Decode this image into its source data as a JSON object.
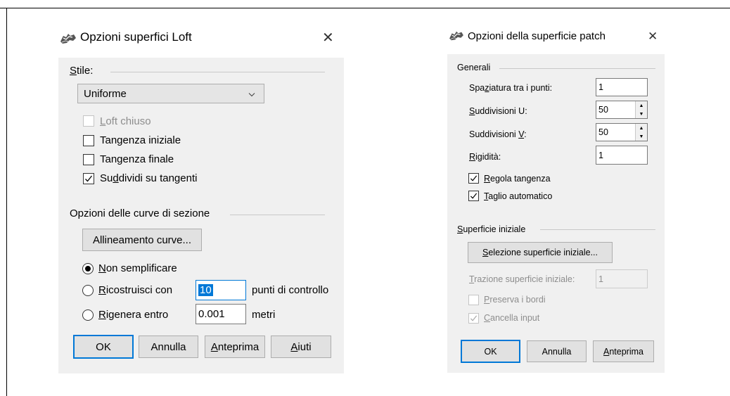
{
  "loft": {
    "title": "Opzioni superfici Loft",
    "style_label": "Stile:",
    "style_value": "Uniforme",
    "closed_loft": "Loft chiuso",
    "start_tangent": "Tangenza iniziale",
    "end_tangent": "Tangenza finale",
    "split_tangent": "Suddividi su tangenti",
    "section_header": "Opzioni delle curve di sezione",
    "align_curves": "Allineamento curve...",
    "no_simplify": "Non semplificare",
    "rebuild_with": "Ricostruisci con",
    "rebuild_value": "10",
    "control_points": "punti di controllo",
    "refit_within": "Rigenera entro",
    "refit_value": "0.001",
    "units": "metri",
    "ok": "OK",
    "cancel": "Annulla",
    "preview": "Anteprima",
    "help": "Aiuti"
  },
  "patch": {
    "title": "Opzioni della superficie patch",
    "general": "Generali",
    "point_spacing_label": "Spaziatura tra i punti:",
    "point_spacing_value": "1",
    "u_spans_label": "Suddivisioni U:",
    "u_spans_value": "50",
    "v_spans_label": "Suddivisioni V:",
    "v_spans_value": "50",
    "stiffness_label": "Rigidità:",
    "stiffness_value": "1",
    "adjust_tangency": "Regola tangenza",
    "auto_trim": "Taglio automatico",
    "starting_surface": "Superficie iniziale",
    "select_starting": "Selezione superficie iniziale...",
    "pull_label": "Trazione superficie iniziale:",
    "pull_value": "1",
    "preserve_edges": "Preserva i bordi",
    "delete_input": "Cancella input",
    "ok": "OK",
    "cancel": "Annulla",
    "preview": "Anteprima"
  },
  "state": {
    "closed_loft_checked": false,
    "start_tangent_checked": false,
    "end_tangent_checked": false,
    "split_tangent_checked": true,
    "adjust_tangency_checked": true,
    "auto_trim_checked": true,
    "preserve_edges_checked": false,
    "delete_input_checked": true,
    "selected_rebuild_option": "no_simplify"
  },
  "colors": {
    "dialog_bg": "#f0f0f0",
    "accent": "#0078d7",
    "disabled_text": "#8d8d8d"
  },
  "icons": [
    "rhino-app-icon",
    "close-icon",
    "chevron-down-icon",
    "checkmark-icon",
    "spin-up-icon",
    "spin-down-icon"
  ]
}
